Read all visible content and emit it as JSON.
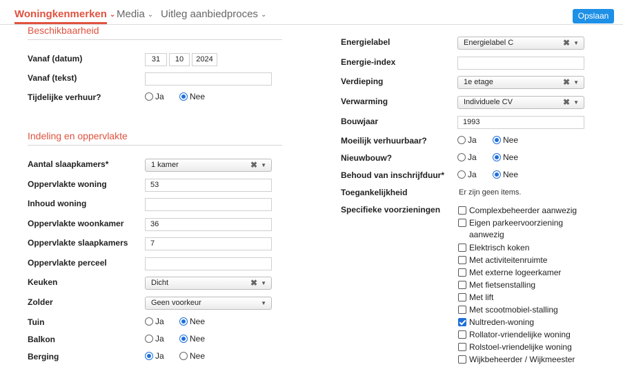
{
  "nav": {
    "tabs": [
      {
        "label": "Woningkenmerken"
      },
      {
        "label": "Media"
      },
      {
        "label": "Uitleg aanbiedproces"
      }
    ],
    "chevron": "⌄",
    "save_label": "Opslaan"
  },
  "colors": {
    "accent": "#e0523f",
    "primary": "#1e90e6",
    "check": "#1e6fd9"
  },
  "icons": {
    "clear": "clear-x-icon",
    "dropdown": "dropdown-arrow-icon"
  },
  "beschikbaarheid": {
    "title": "Beschikbaarheid",
    "vanaf_datum": {
      "label": "Vanaf (datum)",
      "day": "31",
      "month": "10",
      "year": "2024"
    },
    "vanaf_tekst": {
      "label": "Vanaf (tekst)",
      "value": ""
    },
    "tijdelijke_verhuur": {
      "label": "Tijdelijke verhuur?",
      "options": [
        "Ja",
        "Nee"
      ],
      "selected": "Nee"
    }
  },
  "indeling": {
    "title": "Indeling en oppervlakte",
    "aantal_slaapkamers": {
      "label": "Aantal slaapkamers*",
      "value": "1 kamer"
    },
    "oppervlakte_woning": {
      "label": "Oppervlakte woning",
      "value": "53"
    },
    "inhoud_woning": {
      "label": "Inhoud woning",
      "value": ""
    },
    "oppervlakte_woonkamer": {
      "label": "Oppervlakte woonkamer",
      "value": "36"
    },
    "oppervlakte_slaapkamers": {
      "label": "Oppervlakte slaapkamers",
      "value": "7"
    },
    "oppervlakte_perceel": {
      "label": "Oppervlakte perceel",
      "value": ""
    },
    "keuken": {
      "label": "Keuken",
      "value": "Dicht"
    },
    "zolder": {
      "label": "Zolder",
      "value": "Geen voorkeur"
    },
    "tuin": {
      "label": "Tuin",
      "options": [
        "Ja",
        "Nee"
      ],
      "selected": "Nee"
    },
    "balkon": {
      "label": "Balkon",
      "options": [
        "Ja",
        "Nee"
      ],
      "selected": "Nee"
    },
    "berging": {
      "label": "Berging",
      "options": [
        "Ja",
        "Nee"
      ],
      "selected": "Ja"
    }
  },
  "right": {
    "energielabel": {
      "label": "Energielabel",
      "value": "Energielabel C"
    },
    "energie_index": {
      "label": "Energie-index",
      "value": ""
    },
    "verdieping": {
      "label": "Verdieping",
      "value": "1e etage"
    },
    "verwarming": {
      "label": "Verwarming",
      "value": "Individuele CV"
    },
    "bouwjaar": {
      "label": "Bouwjaar",
      "value": "1993"
    },
    "moeilijk_verhuurbaar": {
      "label": "Moeilijk verhuurbaar?",
      "options": [
        "Ja",
        "Nee"
      ],
      "selected": "Nee"
    },
    "nieuwbouw": {
      "label": "Nieuwbouw?",
      "options": [
        "Ja",
        "Nee"
      ],
      "selected": "Nee"
    },
    "behoud_inschrijfduur": {
      "label": "Behoud van inschrijfduur*",
      "options": [
        "Ja",
        "Nee"
      ],
      "selected": "Nee"
    },
    "toegankelijkheid": {
      "label": "Toegankelijkheid",
      "value": "Er zijn geen items."
    },
    "voorzieningen": {
      "label": "Specifieke voorzieningen",
      "items": [
        {
          "label": "Complexbeheerder aanwezig",
          "checked": false
        },
        {
          "label": "Eigen parkeervoorziening aanwezig",
          "checked": false
        },
        {
          "label": "Elektrisch koken",
          "checked": false
        },
        {
          "label": "Met activiteitenruimte",
          "checked": false
        },
        {
          "label": "Met externe logeerkamer",
          "checked": false
        },
        {
          "label": "Met fietsenstalling",
          "checked": false
        },
        {
          "label": "Met lift",
          "checked": false
        },
        {
          "label": "Met scootmobiel-stalling",
          "checked": false
        },
        {
          "label": "Nultreden-woning",
          "checked": true
        },
        {
          "label": "Rollator-vriendelijke woning",
          "checked": false
        },
        {
          "label": "Rolstoel-vriendelijke woning",
          "checked": false
        },
        {
          "label": "Wijkbeheerder / Wijkmeester",
          "checked": false
        }
      ]
    }
  }
}
